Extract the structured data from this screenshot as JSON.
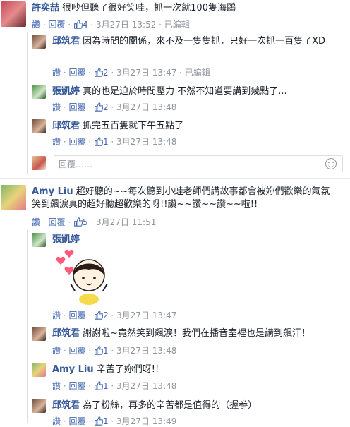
{
  "comments": [
    {
      "author": "許奕喆",
      "text": "很吵但聽了很好笑哇，抓一次就100隻海鷗",
      "actions": {
        "like": "讚",
        "reply": "回覆",
        "likes": "4",
        "time": "3月27日 13:52",
        "edited": "已編輯"
      },
      "replies": [
        {
          "author": "邱筑君",
          "text": "因為時間的關係，來不及一隻隻抓，只好一次抓一百隻了XD",
          "actions": {
            "like": "讚",
            "reply": "回覆",
            "likes": "2",
            "time": "3月27日 13:47",
            "edited": "已編輯"
          }
        },
        {
          "author": "張凱婷",
          "text": "真的也是迫於時間壓力 不然不知道要講到幾點了...",
          "actions": {
            "like": "讚",
            "reply": "回覆",
            "likes": "2",
            "time": "3月27日 13:48"
          }
        },
        {
          "author": "邱筑君",
          "text": "抓完五百隻就下午五點了",
          "actions": {
            "like": "讚",
            "reply": "回覆",
            "likes": "1",
            "time": "3月27日 13:48"
          }
        }
      ],
      "reply_box": {
        "placeholder": "回覆……"
      }
    },
    {
      "author": "Amy Liu",
      "text_line1": "超好聽的~~每次聽到小蛙老師們講故事都會被妳們歡樂的氣氛",
      "text_line2": "笑到飆淚真的超好聽超歡樂的呀!!讚~~讚~~讚~~啦!!",
      "actions": {
        "like": "讚",
        "reply": "回覆",
        "likes": "5",
        "time": "3月27日 11:51"
      },
      "replies": [
        {
          "author": "張凱婷",
          "sticker": "girl-hearts-sticker",
          "actions": {
            "like": "讚",
            "reply": "回覆",
            "likes": "2",
            "time": "3月27日 13:47"
          }
        },
        {
          "author": "邱筑君",
          "text": "謝謝啦~竟然笑到飆淚！我們在播音室裡也是講到飆汗！",
          "actions": {
            "like": "讚",
            "reply": "回覆",
            "likes": "1",
            "time": "3月27日 13:48"
          }
        },
        {
          "author": "Amy Liu",
          "text": "辛苦了妳們呀!!",
          "actions": {
            "like": "讚",
            "reply": "回覆",
            "likes": "1",
            "time": "3月27日 13:48"
          }
        },
        {
          "author": "邱筑君",
          "text": "為了粉絲，再多的辛苦都是值得的（握拳）",
          "actions": {
            "like": "讚",
            "reply": "回覆",
            "likes": "1",
            "time": "3月27日 13:49"
          }
        }
      ]
    }
  ],
  "icons": {
    "like": "thumbs-up-icon",
    "emoji": "smiley-icon"
  },
  "colors": {
    "link": "#365899",
    "action": "#4267b2",
    "meta": "#90949c"
  }
}
